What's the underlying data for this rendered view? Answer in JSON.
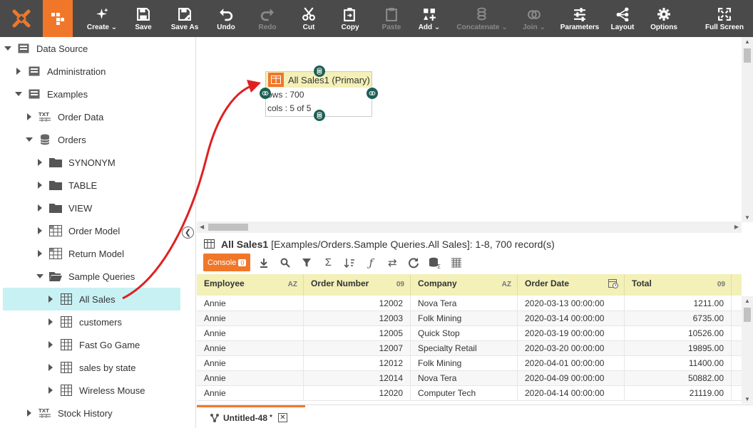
{
  "toolbar": {
    "buttons": [
      {
        "label": "Create",
        "icon": "sparkle-icon",
        "dropdown": true
      },
      {
        "label": "Save",
        "icon": "save-icon"
      },
      {
        "label": "Save As",
        "icon": "save-as-icon"
      },
      {
        "label": "Undo",
        "icon": "undo-icon"
      },
      {
        "label": "Redo",
        "icon": "redo-icon",
        "disabled": true
      },
      {
        "label": "Cut",
        "icon": "scissors-icon"
      },
      {
        "label": "Copy",
        "icon": "copy-icon"
      },
      {
        "label": "Paste",
        "icon": "paste-icon",
        "disabled": true
      },
      {
        "label": "Add",
        "icon": "add-shapes-icon",
        "dropdown": true
      },
      {
        "label": "Concatenate",
        "icon": "concatenate-icon",
        "dropdown": true,
        "disabled": true
      },
      {
        "label": "Join",
        "icon": "join-icon",
        "dropdown": true,
        "disabled": true
      },
      {
        "label": "Parameters",
        "icon": "sliders-icon"
      },
      {
        "label": "Layout",
        "icon": "layout-tree-icon"
      },
      {
        "label": "Options",
        "icon": "gear-icon"
      },
      {
        "label": "Full Screen",
        "icon": "fullscreen-icon"
      }
    ]
  },
  "tree": {
    "items": [
      {
        "label": "Data Source",
        "icon": "datasource-icon",
        "expanded": true
      },
      {
        "label": "Administration",
        "icon": "datasource-icon",
        "expanded": false
      },
      {
        "label": "Examples",
        "icon": "datasource-icon",
        "expanded": true
      },
      {
        "label": "Order Data",
        "icon": "txt-file-icon",
        "expanded": false
      },
      {
        "label": "Orders",
        "icon": "database-icon",
        "expanded": true
      },
      {
        "label": "SYNONYM",
        "icon": "folder-icon",
        "expanded": false
      },
      {
        "label": "TABLE",
        "icon": "folder-icon",
        "expanded": false
      },
      {
        "label": "VIEW",
        "icon": "folder-icon",
        "expanded": false
      },
      {
        "label": "Order Model",
        "icon": "model-icon",
        "expanded": false
      },
      {
        "label": "Return Model",
        "icon": "model-icon",
        "expanded": false
      },
      {
        "label": "Sample Queries",
        "icon": "open-folder-icon",
        "expanded": true
      },
      {
        "label": "All Sales",
        "icon": "table-icon",
        "expanded": false,
        "selected": true
      },
      {
        "label": "customers",
        "icon": "table-icon",
        "expanded": false
      },
      {
        "label": "Fast Go Game",
        "icon": "table-icon",
        "expanded": false
      },
      {
        "label": "sales by state",
        "icon": "table-icon",
        "expanded": false
      },
      {
        "label": "Wireless Mouse",
        "icon": "table-icon",
        "expanded": false
      },
      {
        "label": "Stock History",
        "icon": "txt-file-icon",
        "expanded": false
      }
    ]
  },
  "graph": {
    "node": {
      "title": "All Sales1 (Primary)",
      "rows": "ows : 700",
      "cols": "cols : 5 of 5"
    }
  },
  "panel": {
    "title_bold": "All Sales1",
    "title_rest": "[Examples/Orders.Sample Queries.All Sales]: 1-8, 700 record(s)",
    "console_label": "Console",
    "console_count": "0"
  },
  "grid": {
    "columns": [
      {
        "label": "Employee",
        "tag": "AZ"
      },
      {
        "label": "Order Number",
        "tag": "09"
      },
      {
        "label": "Company",
        "tag": "AZ"
      },
      {
        "label": "Order Date",
        "tag": ""
      },
      {
        "label": "Total",
        "tag": "09"
      }
    ],
    "rows": [
      [
        "Annie",
        "12002",
        "Nova Tera",
        "2020-03-13 00:00:00",
        "1211.00"
      ],
      [
        "Annie",
        "12003",
        "Folk Mining",
        "2020-03-14 00:00:00",
        "6735.00"
      ],
      [
        "Annie",
        "12005",
        "Quick Stop",
        "2020-03-19 00:00:00",
        "10526.00"
      ],
      [
        "Annie",
        "12007",
        "Specialty Retail",
        "2020-03-20 00:00:00",
        "19895.00"
      ],
      [
        "Annie",
        "12012",
        "Folk Mining",
        "2020-04-01 00:00:00",
        "11400.00"
      ],
      [
        "Annie",
        "12014",
        "Nova Tera",
        "2020-04-09 00:00:00",
        "50882.00"
      ],
      [
        "Annie",
        "12020",
        "Computer Tech",
        "2020-04-14 00:00:00",
        "21119.00"
      ]
    ]
  },
  "tabs": [
    {
      "label": "Untitled-48",
      "modified_marker": "*"
    }
  ],
  "colors": {
    "toolbar_bg": "#4a4a4a",
    "accent": "#f0772a",
    "header_bg": "#f3f0b8",
    "selected_bg": "#c8f1f4",
    "port": "#1c5f55",
    "arrow": "#e02020"
  }
}
